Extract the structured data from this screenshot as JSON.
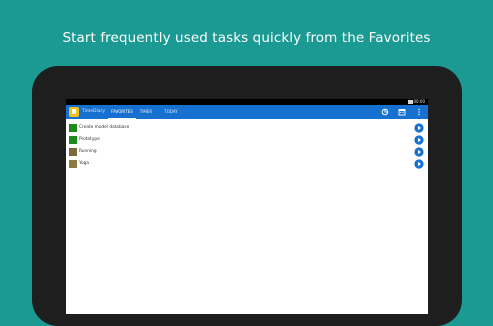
{
  "headline": "Start frequently used tasks quickly from the Favorites",
  "status": {
    "clock": "00:00"
  },
  "app": {
    "title": "TimeDiary",
    "tabs": [
      {
        "label": "FAVORITES",
        "active": true
      },
      {
        "label": "TIMER",
        "active": false
      },
      {
        "label": "TODAY",
        "active": false
      }
    ],
    "icons": [
      "refresh-icon",
      "calendar-icon",
      "overflow-menu-icon"
    ]
  },
  "favorites": [
    {
      "label": "Create model database",
      "color": "#1c8a1c"
    },
    {
      "label": "Prototype",
      "color": "#1c8a1c"
    },
    {
      "label": "Running",
      "color": "#7a6a3a"
    },
    {
      "label": "Yoga",
      "color": "#8a7b40"
    }
  ],
  "colors": {
    "background": "#1b9a94",
    "appbar": "#1570d0",
    "play": "#1570d0"
  }
}
